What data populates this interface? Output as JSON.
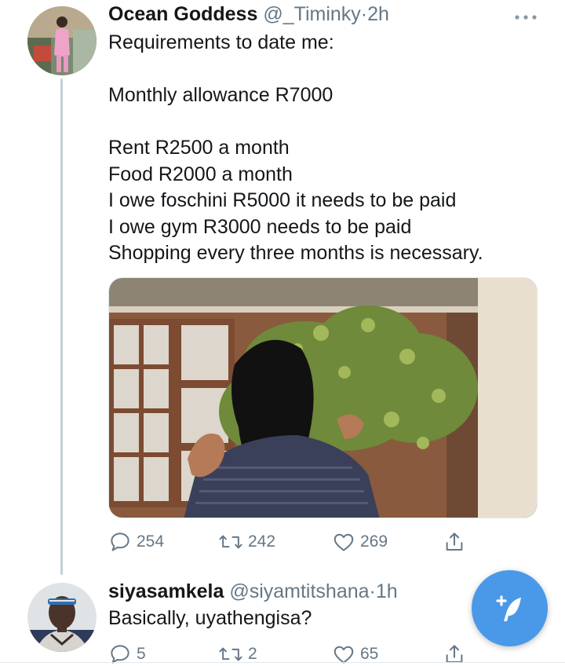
{
  "tweet": {
    "display_name": "Ocean Goddess",
    "handle": "@_Timinky",
    "separator": "·",
    "time": "2h",
    "text_lines": [
      "Requirements to date me:",
      "",
      "Monthly allowance R7000",
      "",
      "Rent R2500 a month",
      "Food R2000 a month",
      "I owe foschini R5000 it needs to be paid",
      "I owe gym R3000 needs to be paid",
      "Shopping every three months is necessary."
    ],
    "actions": {
      "replies": "254",
      "retweets": "242",
      "likes": "269"
    },
    "icons": {
      "more": "more-horizontal-icon",
      "reply": "reply-icon",
      "retweet": "retweet-icon",
      "like": "heart-icon",
      "share": "share-icon"
    }
  },
  "reply": {
    "display_name": "siyasamkela",
    "handle": "@siyamtitshana",
    "separator": "·",
    "time": "1h",
    "text": "Basically, uyathengisa?",
    "actions": {
      "replies": "5",
      "retweets": "2",
      "likes": "65"
    }
  },
  "compose_button": {
    "icon": "compose-feather-icon",
    "color": "#4a99e9"
  },
  "colors": {
    "text": "#14171a",
    "secondary": "#657786",
    "thread_line": "#c4cfd6"
  }
}
